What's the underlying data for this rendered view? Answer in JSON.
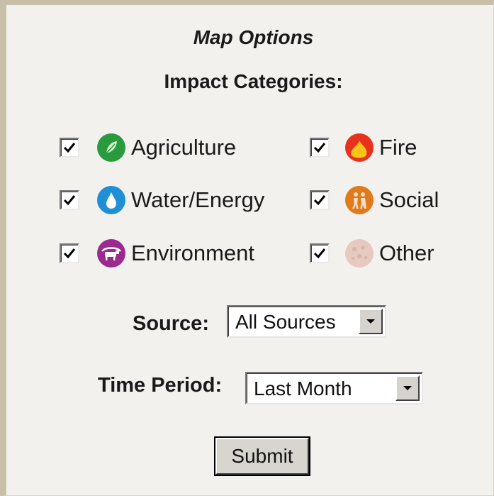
{
  "panel": {
    "title": "Map Options",
    "subtitle": "Impact Categories:"
  },
  "categories": [
    {
      "label": "Agriculture",
      "checked": true,
      "icon": "leaf-icon",
      "color": "#2a9a3f"
    },
    {
      "label": "Fire",
      "checked": true,
      "icon": "flame-icon",
      "color": "#e9321e"
    },
    {
      "label": "Water/Energy",
      "checked": true,
      "icon": "water-drop-icon",
      "color": "#1f8fd6"
    },
    {
      "label": "Social",
      "checked": true,
      "icon": "people-icon",
      "color": "#e07a1c"
    },
    {
      "label": "Environment",
      "checked": true,
      "icon": "cow-icon",
      "color": "#9b2a8e"
    },
    {
      "label": "Other",
      "checked": true,
      "icon": "other-icon",
      "color": "#e6c9bf"
    }
  ],
  "source": {
    "label": "Source:",
    "value": "All Sources"
  },
  "time_period": {
    "label": "Time Period:",
    "value": "Last Month"
  },
  "submit_label": "Submit",
  "colors": {
    "background": "#f3f1ee",
    "border": "#c8bfa8"
  }
}
